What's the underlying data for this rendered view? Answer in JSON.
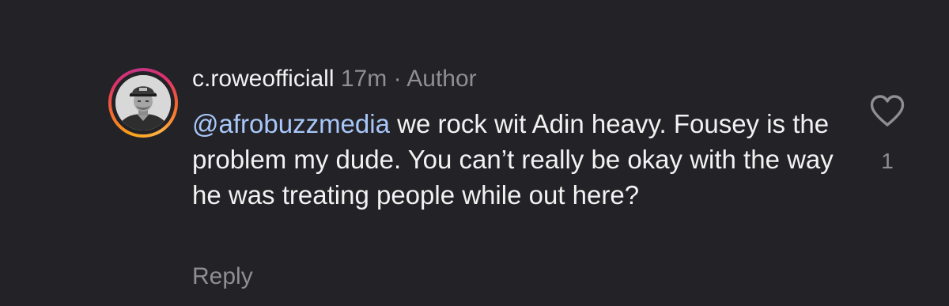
{
  "comment": {
    "username": "c.roweofficiall",
    "time": "17m",
    "separator": "·",
    "role": "Author",
    "mention": "@afrobuzzmedia",
    "text": " we rock wit Adin heavy. Fousey is the problem my dude. You can’t really be okay with the way he was treating people while out here?",
    "like_count": "1",
    "reply_label": "Reply",
    "avatar_icon": "profile-photo",
    "like_icon": "heart-outline-icon"
  },
  "colors": {
    "background": "#232327",
    "text": "#f2f2f2",
    "muted": "#8e8e93",
    "mention": "#a8c7fa"
  }
}
